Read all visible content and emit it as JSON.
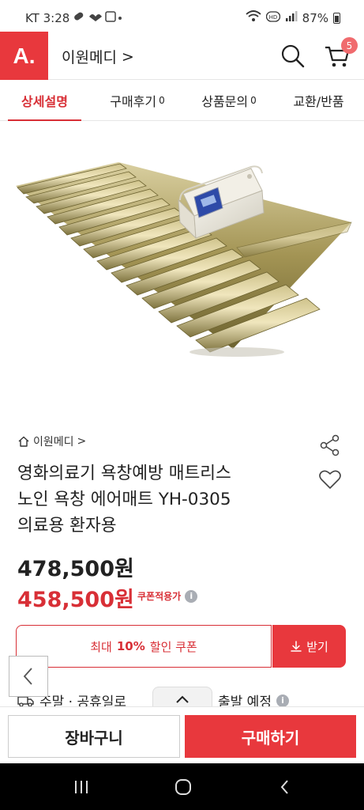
{
  "status_bar": {
    "carrier_time": "KT 3:28",
    "battery": "87%"
  },
  "header": {
    "logo_text": "A.",
    "shop_name": "이원메디",
    "shop_chevron": ">",
    "cart_count": "5"
  },
  "tabs": [
    {
      "label": "상세설명",
      "count": ""
    },
    {
      "label": "구매후기",
      "count": "0"
    },
    {
      "label": "상품문의",
      "count": "0"
    },
    {
      "label": "교환/반품",
      "count": ""
    }
  ],
  "product": {
    "breadcrumb": "이원메디",
    "breadcrumb_chevron": ">",
    "title_lines": [
      "영화의료기 욕창예방 매트리스",
      "노인 욕창 에어매트 YH-0305",
      "의료용 환자용"
    ],
    "price": "478,500원",
    "coupon_price": "458,500원",
    "coupon_note": "쿠폰적용가",
    "info_glyph": "i"
  },
  "coupon": {
    "prefix": "최대",
    "rate": "10%",
    "suffix": "할인 쿠폰",
    "download": "받기"
  },
  "shipping": {
    "text": "주말 · 공휴일로",
    "later": "출발 예정"
  },
  "bottom": {
    "cart_label": "장바구니",
    "buy_label": "구매하기"
  },
  "colors": {
    "brand": "#e8383d",
    "accent_text": "#d82f36"
  },
  "icons": [
    "search-icon",
    "cart-icon",
    "home-icon",
    "share-icon",
    "heart-icon",
    "download-icon",
    "chevron-left-icon",
    "chevron-up-icon",
    "truck-icon"
  ]
}
